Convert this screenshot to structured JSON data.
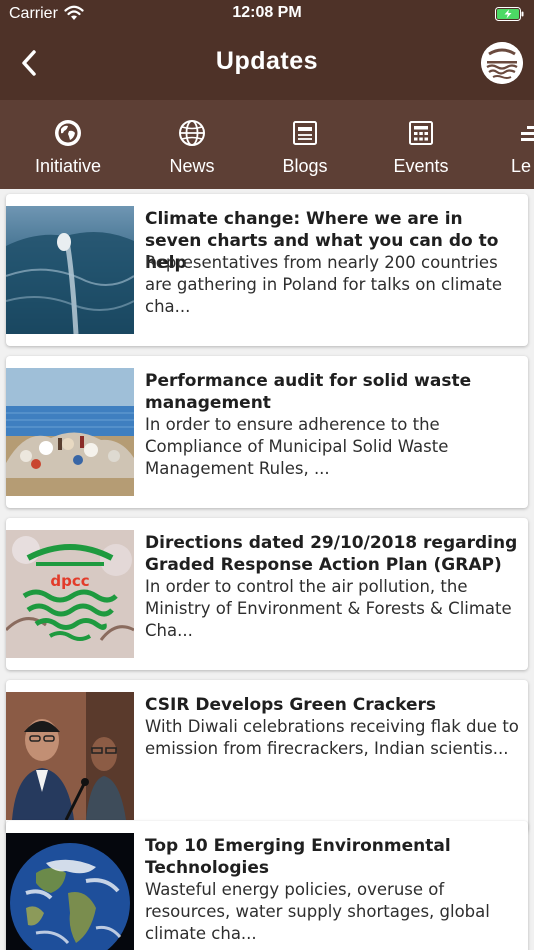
{
  "status_bar": {
    "carrier": "Carrier",
    "time": "12:08 PM"
  },
  "header": {
    "title": "Updates"
  },
  "tabs": [
    {
      "label": "Initiative",
      "icon": "globe-icon"
    },
    {
      "label": "News",
      "icon": "world-grid-icon"
    },
    {
      "label": "Blogs",
      "icon": "document-icon"
    },
    {
      "label": "Events",
      "icon": "calendar-icon"
    },
    {
      "label": "Le",
      "icon": "list-icon"
    }
  ],
  "articles": [
    {
      "title": "Climate change: Where we are in seven charts and what you can do to help",
      "summary": "Representatives from nearly 200 countries are gathering in Poland for talks on climate cha...",
      "image": "ocean-wave-image"
    },
    {
      "title": "Performance audit for solid waste management",
      "summary": "In order to ensure adherence to the Compliance of Municipal Solid Waste Management Rules, ...",
      "image": "waste-dump-image"
    },
    {
      "title": "Directions dated 29/10/2018 regarding Graded Response Action Plan (GRAP)",
      "summary": "In order to control the air pollution, the Ministry of Environment & Forests & Climate Cha...",
      "image": "dpcc-logo-image",
      "image_text": "dpcc"
    },
    {
      "title": "CSIR Develops Green Crackers",
      "summary": "With Diwali celebrations receiving flak due to emission from firecrackers, Indian scientis...",
      "image": "press-conference-image"
    },
    {
      "title": "Top 10 Emerging Environmental Technologies",
      "summary": "Wasteful energy policies, overuse of resources, water supply shortages, global climate cha...",
      "image": "earth-image"
    }
  ],
  "colors": {
    "header": "#4e3228",
    "tabbar": "#5d3f35",
    "card": "#ffffff",
    "background": "#f1f1f1"
  }
}
